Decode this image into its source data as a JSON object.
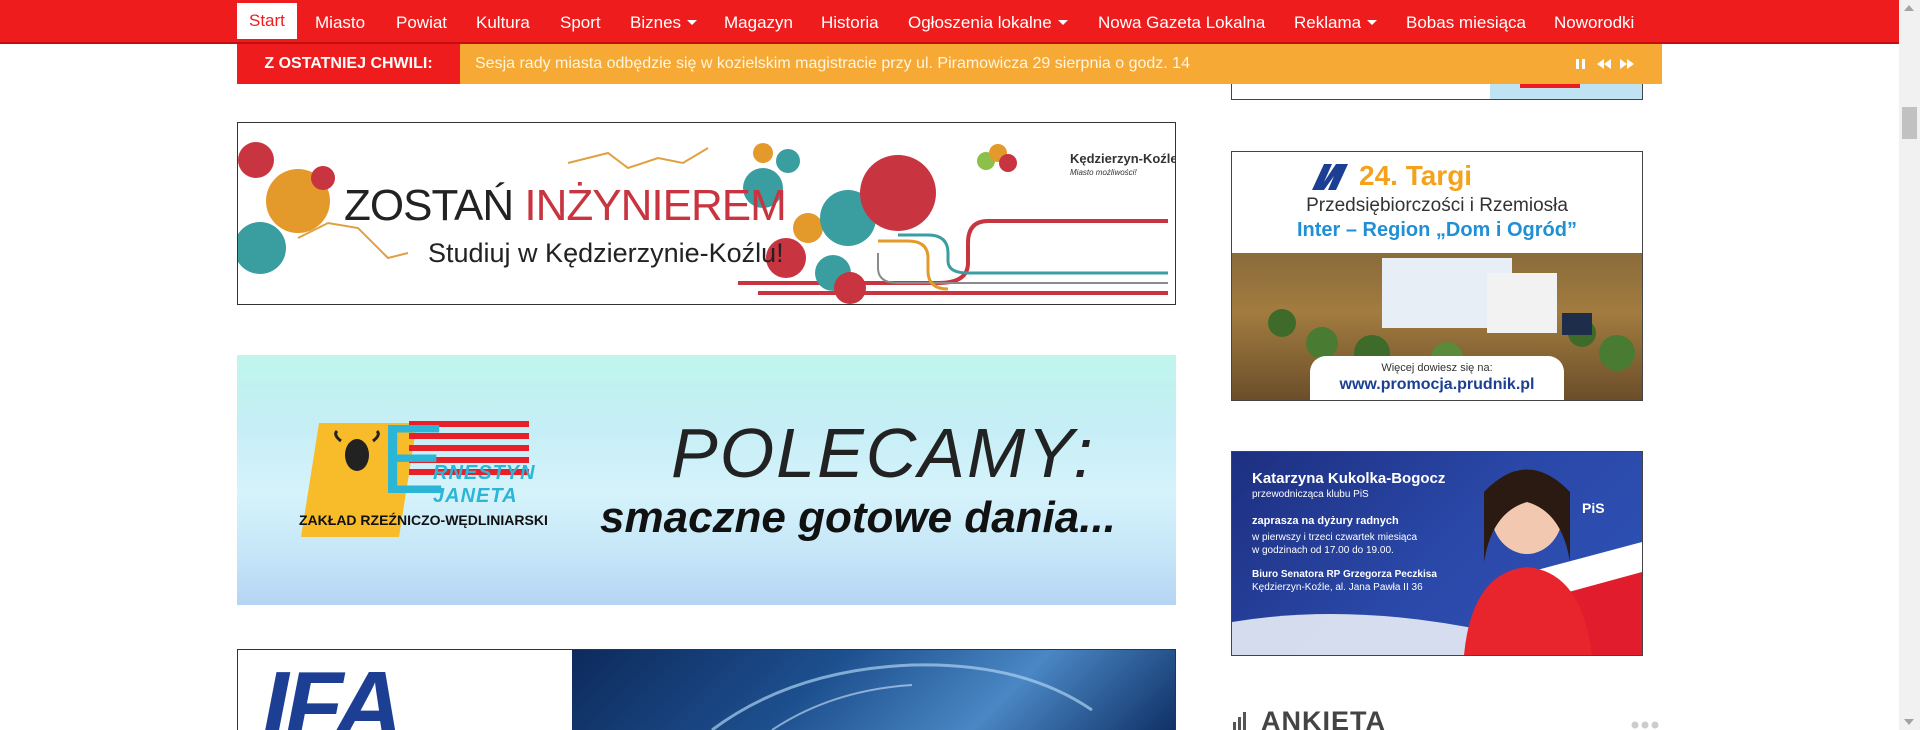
{
  "nav": {
    "items": [
      {
        "label": "Start"
      },
      {
        "label": "Miasto"
      },
      {
        "label": "Powiat"
      },
      {
        "label": "Kultura"
      },
      {
        "label": "Sport"
      },
      {
        "label": "Biznes"
      },
      {
        "label": "Magazyn"
      },
      {
        "label": "Historia"
      },
      {
        "label": "Ogłoszenia lokalne"
      },
      {
        "label": "Nowa Gazeta Lokalna"
      },
      {
        "label": "Reklama"
      },
      {
        "label": "Bobas miesiąca"
      },
      {
        "label": "Noworodki"
      }
    ]
  },
  "breaking": {
    "label": "Z OSTATNIEJ CHWILI:",
    "text": "Sesja rady miasta odbędzie się w kozielskim magistracie przy ul. Piramowicza 29 sierpnia o godz. 14"
  },
  "banner_engineer": {
    "title_a": "ZOSTAŃ ",
    "title_b": "INŻYNIEREM",
    "subtitle": "Studiuj w Kędzierzynie-Koźlu!",
    "city_name": "Kędzierzyn-Koźle",
    "city_tagline": "Miasto możliwości!"
  },
  "banner_polecamy": {
    "brand_line1": "RNESTYN",
    "brand_line2": "JANETA",
    "brand_letter": "E",
    "brand_caption": "ZAKŁAD RZEŹNICZO-WĘDLINIARSKI",
    "headline": "POLECAMY:",
    "subline": "smaczne gotowe dania..."
  },
  "banner_ifa": {
    "logo": "IFA"
  },
  "banner_targi": {
    "title": "24. Targi",
    "line2": "Przedsiębiorczości i Rzemiosła",
    "line3": "Inter – Region „Dom i Ogród”",
    "more": "Więcej dowiesz się na:",
    "url": "www.promocja.prudnik.pl"
  },
  "banner_kukolka": {
    "name": "Katarzyna Kukolka-Bogocz",
    "role": "przewodnicząca klubu PiS",
    "invite": "zaprasza na dyżury radnych",
    "when1": "w pierwszy i trzeci czwartek miesiąca",
    "when2": "w godzinach od 17.00 do 19.00.",
    "office": "Biuro Senatora RP Grzegorza Peczkisa",
    "address": "Kędzierzyn-Koźle, al. Jana Pawła II 36",
    "party": "PiS"
  },
  "poll": {
    "title": "ANKIETA"
  },
  "colors": {
    "nav_red": "#ee1c1c",
    "breaking_orange": "#f7a936",
    "accent_blue": "#1f8fd6"
  }
}
